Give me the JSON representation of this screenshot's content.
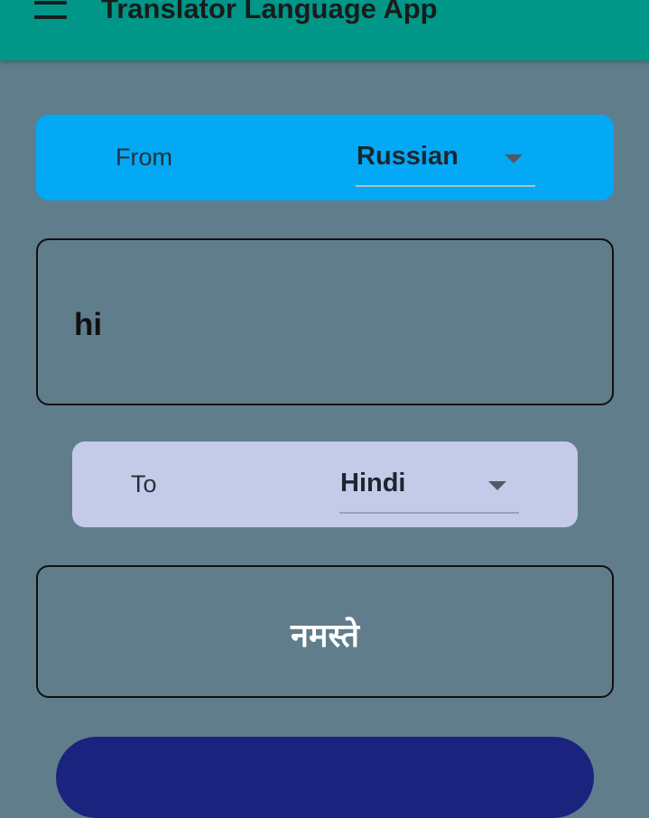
{
  "app_bar": {
    "title": "Translator Language App",
    "menu_icon": "hamburger-menu-icon",
    "color": "#009688"
  },
  "background_color": "#607d8b",
  "source_language": {
    "label": "From",
    "selected": "Russian",
    "card_color": "#03a9f4"
  },
  "input": {
    "value": "hi"
  },
  "target_language": {
    "label": "To",
    "selected": "Hindi",
    "card_color": "#c5cae9"
  },
  "output": {
    "value": "नमस्ते"
  },
  "translate_button": {
    "color": "#1a237e"
  }
}
